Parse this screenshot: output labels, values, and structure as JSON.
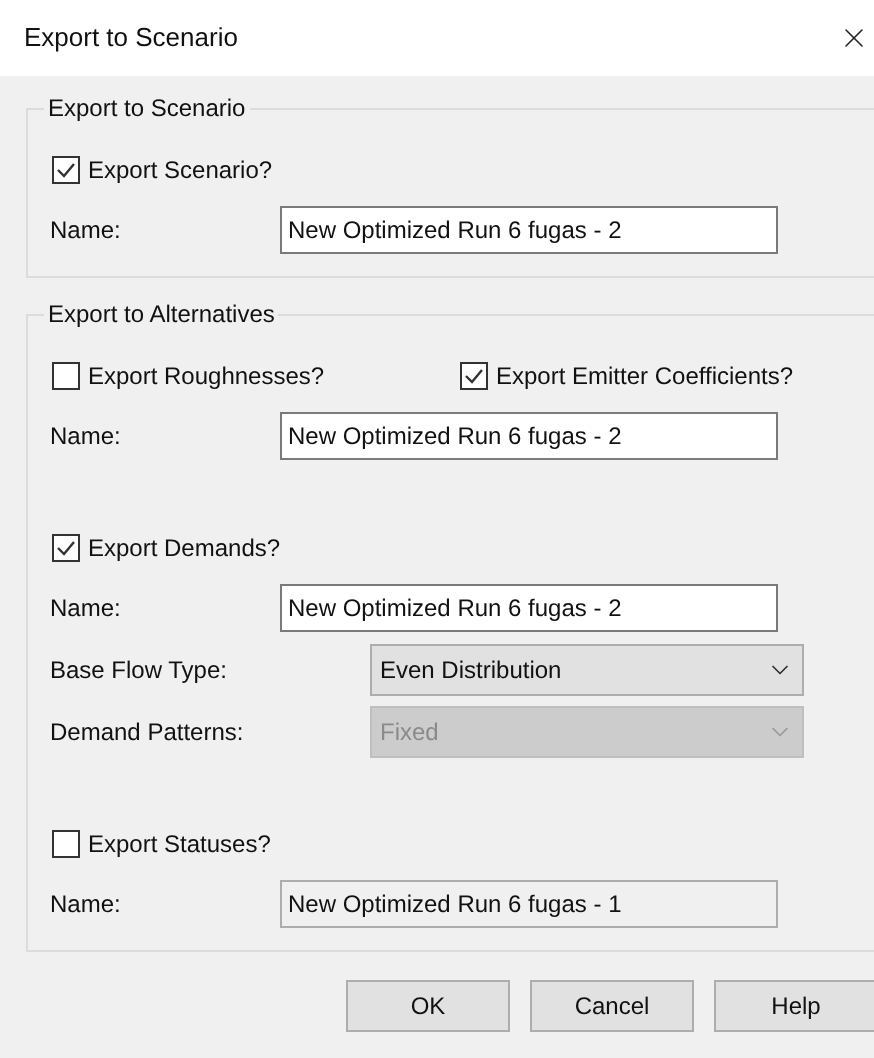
{
  "window": {
    "title": "Export to Scenario"
  },
  "groups": [
    {
      "title": "Export to Scenario",
      "sections": [
        [
          {
            "kind": "checkboxes",
            "options": [
              {
                "label": "Export Scenario?",
                "checked": true
              }
            ]
          },
          {
            "kind": "text",
            "label": "Name:",
            "value": "New Optimized Run 6 fugas - 2",
            "disabled": false
          }
        ]
      ]
    },
    {
      "title": "Export to Alternatives",
      "sections": [
        [
          {
            "kind": "checkboxes",
            "options": [
              {
                "label": "Export Roughnesses?",
                "checked": false
              },
              {
                "label": "Export Emitter Coefficients?",
                "checked": true
              }
            ]
          },
          {
            "kind": "text",
            "label": "Name:",
            "value": "New Optimized Run 6 fugas - 2",
            "disabled": false
          }
        ],
        [
          {
            "kind": "checkboxes",
            "options": [
              {
                "label": "Export Demands?",
                "checked": true
              }
            ]
          },
          {
            "kind": "text",
            "label": "Name:",
            "value": "New Optimized Run 6 fugas - 2",
            "disabled": false
          },
          {
            "kind": "select",
            "label": "Base Flow Type:",
            "value": "Even Distribution",
            "disabled": false
          },
          {
            "kind": "select",
            "label": "Demand Patterns:",
            "value": "Fixed",
            "disabled": true
          }
        ],
        [
          {
            "kind": "checkboxes",
            "options": [
              {
                "label": "Export Statuses?",
                "checked": false
              }
            ]
          },
          {
            "kind": "text",
            "label": "Name:",
            "value": "New Optimized Run 6 fugas - 1",
            "disabled": true
          }
        ]
      ]
    }
  ],
  "buttons": [
    "OK",
    "Cancel",
    "Help"
  ]
}
